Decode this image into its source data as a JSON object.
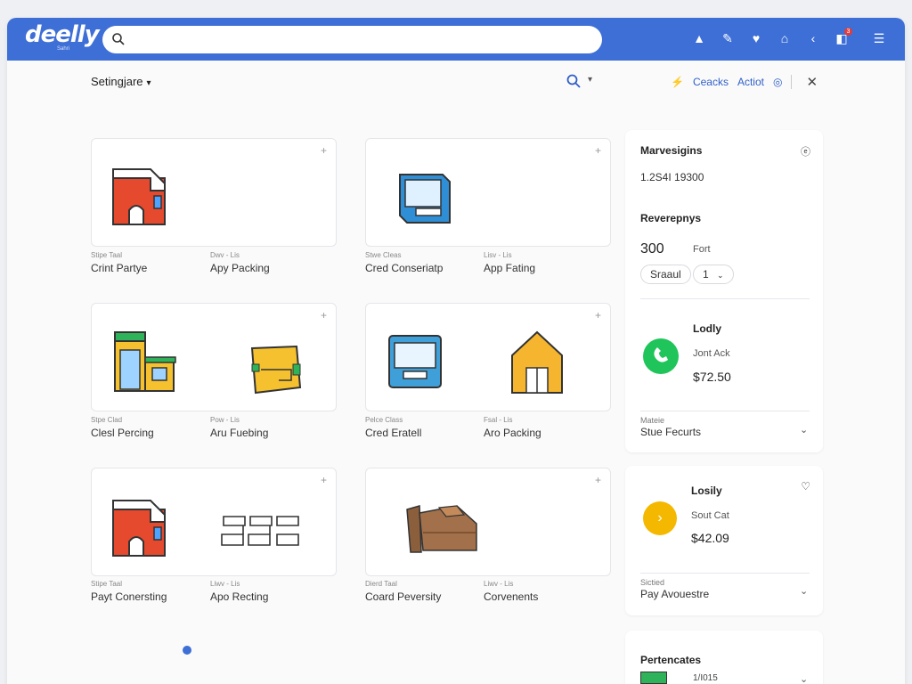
{
  "app": {
    "logo": "deelly",
    "logo_sub": "Sahri"
  },
  "search": {
    "placeholder": ""
  },
  "toolbar": {
    "notification_count": "3"
  },
  "subbar": {
    "settings_label": "Setingjare",
    "actions": [
      "Ceacks",
      "Actiot"
    ]
  },
  "cards": [
    {
      "left": {
        "small": "Stipe Taal",
        "main": "Crint Partye"
      },
      "right": {
        "small": "Dwv - Lis",
        "main": "Apy Packing"
      }
    },
    {
      "left": {
        "small": "Stwe Cleas",
        "main": "Cred Conseriatp"
      },
      "right": {
        "small": "Lisv - Lis",
        "main": "App Fating"
      }
    },
    {
      "left": {
        "small": "Stpe Clad",
        "main": "Clesl Percing"
      },
      "right": {
        "small": "Pow - Lis",
        "main": "Aru Fuebing"
      }
    },
    {
      "left": {
        "small": "Pelce Class",
        "main": "Cred Eratell"
      },
      "right": {
        "small": "Fsal - Lis",
        "main": "Aro Packing"
      }
    },
    {
      "left": {
        "small": "Stipe Taal",
        "main": "Payt Conersting"
      },
      "right": {
        "small": "Liwv - Lis",
        "main": "Apo Recting"
      }
    },
    {
      "left": {
        "small": "Dierd Taal",
        "main": "Coard Peversity"
      },
      "right": {
        "small": "Liwv - Lis",
        "main": "Corvenents"
      }
    }
  ],
  "panel1": {
    "title": "Marvesigins",
    "value": "1.2S4I 19300",
    "subtitle": "Reverepnys",
    "amount": "300",
    "amount_label": "Fort",
    "pill_a": "Sraaul",
    "pill_b": "1"
  },
  "panel1b": {
    "title": "Lodly",
    "name": "Jont Ack",
    "price": "$72.50",
    "footer_small": "Mateie",
    "footer_main": "Stue Fecurts"
  },
  "panel2": {
    "title": "Losily",
    "name": "Sout Cat",
    "price": "$42.09",
    "footer_small": "Sictied",
    "footer_main": "Pay Avouestre"
  },
  "panel3": {
    "title": "Pertencates",
    "item": "1/I015"
  },
  "colors": {
    "brand": "#3d6fd6",
    "green": "#1fc45a",
    "yellow": "#f5b800"
  }
}
